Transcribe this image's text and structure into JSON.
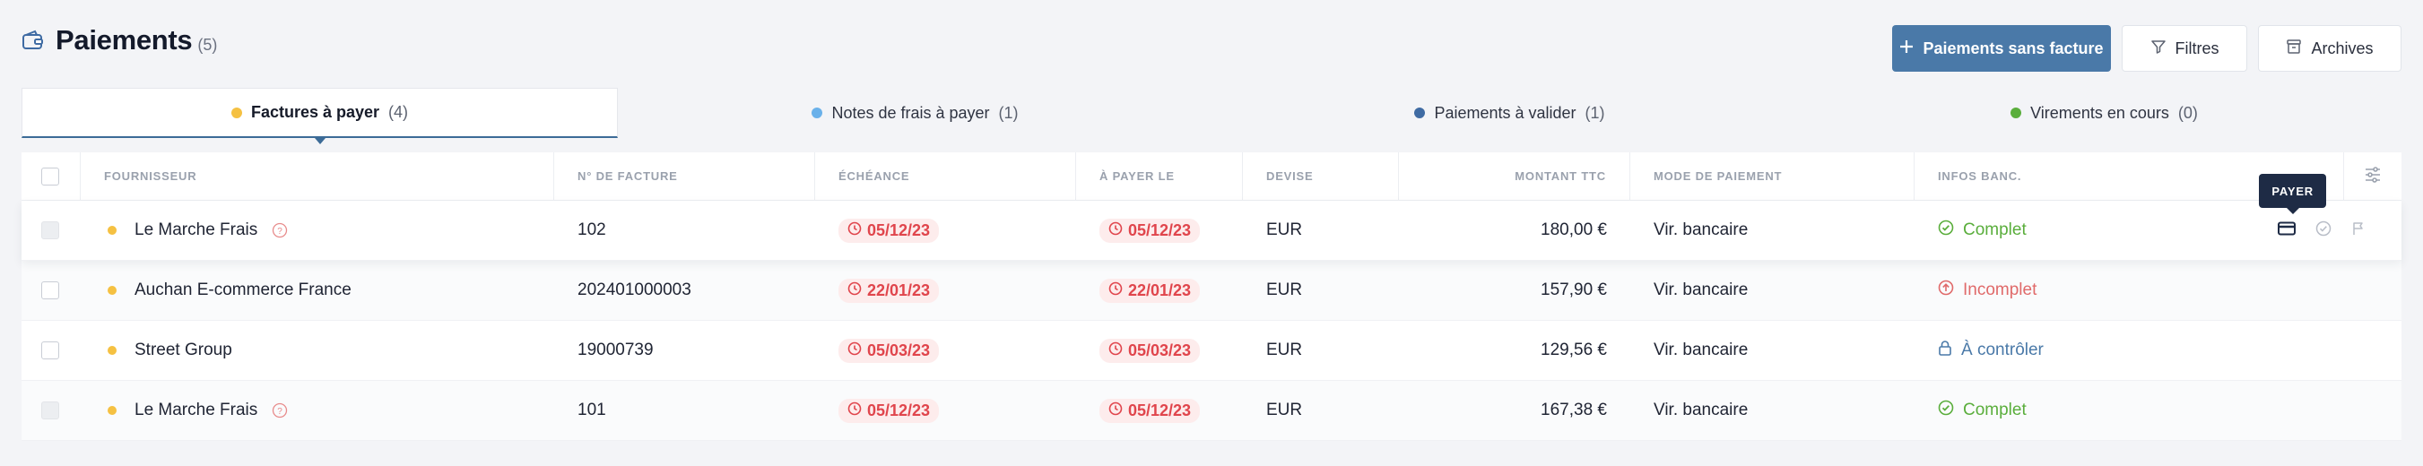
{
  "header": {
    "title": "Paiements",
    "count": "(5)",
    "primary_button": "Paiements sans facture",
    "filters_button": "Filtres",
    "archives_button": "Archives"
  },
  "tabs": [
    {
      "label": "Factures à payer",
      "count": "(4)",
      "dot_color": "#f5c142"
    },
    {
      "label": "Notes de frais à payer",
      "count": "(1)",
      "dot_color": "#6ab1ea"
    },
    {
      "label": "Paiements à valider",
      "count": "(1)",
      "dot_color": "#3f6ba3"
    },
    {
      "label": "Virements en cours",
      "count": "(0)",
      "dot_color": "#5aae3c"
    }
  ],
  "table": {
    "columns": {
      "supplier": "FOURNISSEUR",
      "invoice": "N° DE FACTURE",
      "due": "ÉCHÉANCE",
      "pay_on": "À PAYER LE",
      "currency": "DEVISE",
      "amount": "MONTANT TTC",
      "mode": "MODE DE PAIEMENT",
      "bank": "INFOS BANC."
    },
    "rows": [
      {
        "supplier": "Le Marche Frais",
        "invoice": "102",
        "due": "05/12/23",
        "pay_on": "05/12/23",
        "currency": "EUR",
        "amount": "180,00 €",
        "mode": "Vir. bancaire",
        "bank": "Complet"
      },
      {
        "supplier": "Auchan E-commerce France",
        "invoice": "202401000003",
        "due": "22/01/23",
        "pay_on": "22/01/23",
        "currency": "EUR",
        "amount": "157,90 €",
        "mode": "Vir. bancaire",
        "bank": "Incomplet"
      },
      {
        "supplier": "Street Group",
        "invoice": "19000739",
        "due": "05/03/23",
        "pay_on": "05/03/23",
        "currency": "EUR",
        "amount": "129,56 €",
        "mode": "Vir. bancaire",
        "bank": "À contrôler"
      },
      {
        "supplier": "Le Marche Frais",
        "invoice": "101",
        "due": "05/12/23",
        "pay_on": "05/12/23",
        "currency": "EUR",
        "amount": "167,38 €",
        "mode": "Vir. bancaire",
        "bank": "Complet"
      }
    ]
  },
  "tooltip": "PAYER",
  "colors": {
    "accent": "#4a79a8",
    "complete": "#5aae3c",
    "incomplete": "#e06a6a",
    "to_check": "#4a79a8",
    "overdue": "#e0454c"
  }
}
